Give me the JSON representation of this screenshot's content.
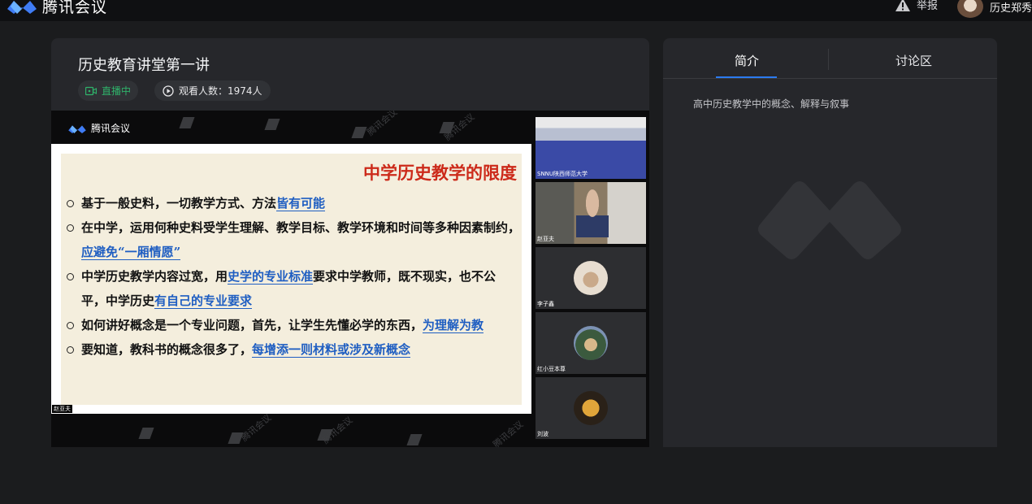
{
  "topbar": {
    "brand_name": "腾讯会议",
    "report_label": "举报",
    "user_name": "历史郑秀"
  },
  "meeting": {
    "title": "历史教育讲堂第一讲",
    "live_label": "直播中",
    "viewers_label": "观看人数：1974人",
    "watermark_text": "腾讯会议"
  },
  "slide": {
    "title": "中学历史教学的限度",
    "bullets": [
      {
        "plain": "基于一般史料，一切教学方式、方法",
        "highlight": "皆有可能",
        "tail": ""
      },
      {
        "plain": "在中学，运用何种史料受学生理解、教学目标、教学环境和时间等多种因素制约，",
        "highlight": "应避免“一厢情愿”",
        "tail": ""
      },
      {
        "plain": "中学历史教学内容过宽，用",
        "highlight": "史学的专业标准",
        "tail": "要求中学教师，既不现实，也不公平，中学历史",
        "highlight2": "有自己的专业要求"
      },
      {
        "plain": "如何讲好概念是一个专业问题，首先，让学生先懂必学的东西，",
        "highlight": "为理解为教",
        "tail": ""
      },
      {
        "plain": "要知道，教科书的概念很多了，",
        "highlight": "每增添一则材料或涉及新概念",
        "tail": ""
      }
    ],
    "speaker_label": "赵亚夫"
  },
  "participants": [
    {
      "label": "SNNU陕西师范大学"
    },
    {
      "label": "赵亚夫"
    },
    {
      "label": "李子鑫"
    },
    {
      "label": "红小豆本尊"
    },
    {
      "label": "刘波"
    }
  ],
  "sidebar": {
    "tabs": [
      "简介",
      "讨论区"
    ],
    "active_tab": "简介",
    "intro_text": "高中历史教学中的概念、解释与叙事"
  },
  "colors": {
    "accent": "#2b7bf0",
    "live": "#2fb26a",
    "slide_title": "#cc2a1a",
    "highlight": "#1f5ec2"
  }
}
